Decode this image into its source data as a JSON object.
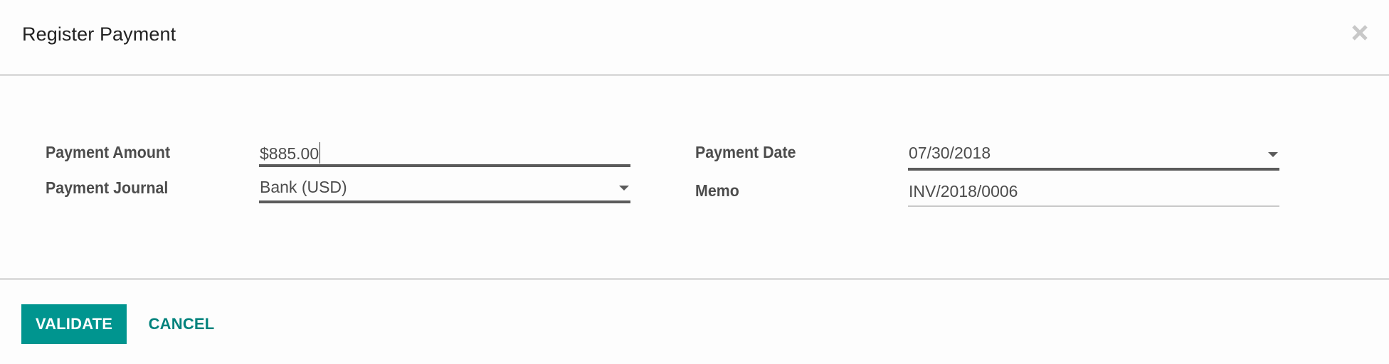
{
  "dialog": {
    "title": "Register Payment",
    "close_icon": "close-icon"
  },
  "form": {
    "left": {
      "payment_amount": {
        "label": "Payment Amount",
        "value": "$885.00"
      },
      "payment_journal": {
        "label": "Payment Journal",
        "value": "Bank (USD)",
        "icon": "caret-down-icon"
      }
    },
    "right": {
      "payment_date": {
        "label": "Payment Date",
        "value": "07/30/2018",
        "icon": "caret-down-icon"
      },
      "memo": {
        "label": "Memo",
        "value": "INV/2018/0006"
      }
    }
  },
  "footer": {
    "validate_label": "VALIDATE",
    "cancel_label": "CANCEL"
  },
  "colors": {
    "primary": "#00958f",
    "link": "#00827c"
  }
}
